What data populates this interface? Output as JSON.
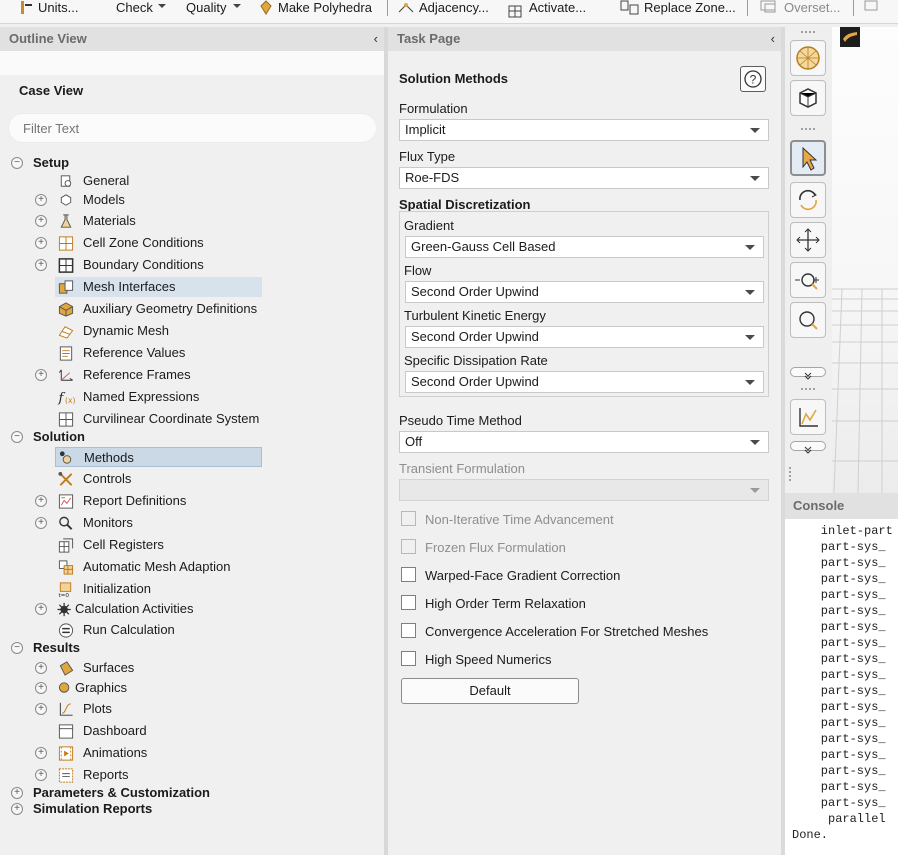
{
  "toolbar": {
    "items": [
      {
        "label": "Units..."
      },
      {
        "label": "Check"
      },
      {
        "label": "Quality"
      },
      {
        "label": "Make Polyhedra"
      },
      {
        "label": "Adjacency..."
      },
      {
        "label": "Activate..."
      },
      {
        "label": "Replace Zone..."
      },
      {
        "label": "Overset..."
      }
    ]
  },
  "outline": {
    "title": "Outline View",
    "tab": "Case View",
    "filter_placeholder": "Filter Text",
    "tree": [
      {
        "label": "Setup",
        "level": 0,
        "bold": true,
        "expander": "minus"
      },
      {
        "label": "General",
        "level": 1,
        "icon": "general-icon"
      },
      {
        "label": "Models",
        "level": 1,
        "icon": "models-icon",
        "expander": "plus"
      },
      {
        "label": "Materials",
        "level": 1,
        "icon": "materials-icon",
        "expander": "plus"
      },
      {
        "label": "Cell Zone Conditions",
        "level": 1,
        "icon": "cell-zone-icon",
        "expander": "plus"
      },
      {
        "label": "Boundary Conditions",
        "level": 1,
        "icon": "boundary-icon",
        "expander": "plus"
      },
      {
        "label": "Mesh Interfaces",
        "level": 1,
        "icon": "mesh-interfaces-icon",
        "highlighted": true
      },
      {
        "label": "Auxiliary Geometry Definitions",
        "level": 1,
        "icon": "auxiliary-geometry-icon"
      },
      {
        "label": "Dynamic Mesh",
        "level": 1,
        "icon": "dynamic-mesh-icon"
      },
      {
        "label": "Reference Values",
        "level": 1,
        "icon": "reference-values-icon"
      },
      {
        "label": "Reference Frames",
        "level": 1,
        "icon": "reference-frames-icon",
        "expander": "plus"
      },
      {
        "label": "Named Expressions",
        "level": 1,
        "icon": "named-expressions-icon"
      },
      {
        "label": "Curvilinear Coordinate System",
        "level": 1,
        "icon": "curvilinear-icon"
      },
      {
        "label": "Solution",
        "level": 0,
        "bold": true,
        "expander": "minus"
      },
      {
        "label": "Methods",
        "level": 1,
        "icon": "methods-icon",
        "selected": true
      },
      {
        "label": "Controls",
        "level": 1,
        "icon": "controls-icon"
      },
      {
        "label": "Report Definitions",
        "level": 1,
        "icon": "report-definitions-icon",
        "expander": "plus"
      },
      {
        "label": "Monitors",
        "level": 1,
        "icon": "monitors-icon",
        "expander": "plus"
      },
      {
        "label": "Cell Registers",
        "level": 1,
        "icon": "cell-registers-icon"
      },
      {
        "label": "Automatic Mesh Adaption",
        "level": 1,
        "icon": "mesh-adaption-icon"
      },
      {
        "label": "Initialization",
        "level": 1,
        "icon": "initialization-icon"
      },
      {
        "label": "Calculation Activities",
        "level": 1,
        "icon": "calculation-activities-icon",
        "expander": "plus"
      },
      {
        "label": "Run Calculation",
        "level": 1,
        "icon": "run-calculation-icon"
      },
      {
        "label": "Results",
        "level": 0,
        "bold": true,
        "expander": "minus"
      },
      {
        "label": "Surfaces",
        "level": 1,
        "icon": "surfaces-icon",
        "expander": "plus"
      },
      {
        "label": "Graphics",
        "level": 1,
        "icon": "graphics-icon",
        "expander": "plus"
      },
      {
        "label": "Plots",
        "level": 1,
        "icon": "plots-icon",
        "expander": "plus"
      },
      {
        "label": "Dashboard",
        "level": 1,
        "icon": "dashboard-icon"
      },
      {
        "label": "Animations",
        "level": 1,
        "icon": "animations-icon",
        "expander": "plus"
      },
      {
        "label": "Reports",
        "level": 1,
        "icon": "reports-icon",
        "expander": "plus"
      },
      {
        "label": "Parameters & Customization",
        "level": 0,
        "bold": true,
        "expander": "plus"
      },
      {
        "label": "Simulation Reports",
        "level": 0,
        "bold": true,
        "expander": "plus"
      }
    ]
  },
  "task": {
    "title": "Task Page",
    "heading": "Solution Methods",
    "help": "?",
    "formulation": {
      "label": "Formulation",
      "value": "Implicit"
    },
    "flux_type": {
      "label": "Flux Type",
      "value": "Roe-FDS"
    },
    "spatial": {
      "label": "Spatial Discretization",
      "gradient": {
        "label": "Gradient",
        "value": "Green-Gauss Cell Based"
      },
      "flow": {
        "label": "Flow",
        "value": "Second Order Upwind"
      },
      "tke": {
        "label": "Turbulent Kinetic Energy",
        "value": "Second Order Upwind"
      },
      "sdr": {
        "label": "Specific Dissipation Rate",
        "value": "Second Order Upwind"
      }
    },
    "pseudo_time": {
      "label": "Pseudo Time Method",
      "value": "Off"
    },
    "transient": {
      "label": "Transient Formulation",
      "value": ""
    },
    "checkboxes": [
      {
        "label": "Non-Iterative Time Advancement",
        "checked": false,
        "enabled": false
      },
      {
        "label": "Frozen Flux Formulation",
        "checked": false,
        "enabled": false
      },
      {
        "label": "Warped-Face Gradient Correction",
        "checked": false,
        "enabled": true
      },
      {
        "label": "High Order Term Relaxation",
        "checked": false,
        "enabled": true
      },
      {
        "label": "Convergence Acceleration For Stretched Meshes",
        "checked": false,
        "enabled": true
      },
      {
        "label": "High Speed Numerics",
        "checked": false,
        "enabled": true
      }
    ],
    "default_button": "Default"
  },
  "graphics_toolbar": {
    "buttons": [
      "fit-view-icon",
      "isometric-view-icon",
      "select-pointer-icon",
      "rotate-icon",
      "pan-icon",
      "zoom-in-out-icon",
      "zoom-box-icon",
      "overflow-chevron-icon",
      "view-props-icon",
      "overflow-chevron-icon"
    ]
  },
  "console": {
    "title": "Console",
    "lines": [
      "    inlet-part",
      "    part-sys_",
      "    part-sys_",
      "    part-sys_",
      "    part-sys_",
      "    part-sys_",
      "    part-sys_",
      "    part-sys_",
      "    part-sys_",
      "    part-sys_",
      "    part-sys_",
      "    part-sys_",
      "    part-sys_",
      "    part-sys_",
      "    part-sys_",
      "    part-sys_",
      "    part-sys_",
      "    part-sys_",
      "     parallel",
      "Done."
    ]
  },
  "colors": {
    "panel_header": "#e1e1e1",
    "selection": "#cbd9e7",
    "background": "#f0f0f0"
  }
}
